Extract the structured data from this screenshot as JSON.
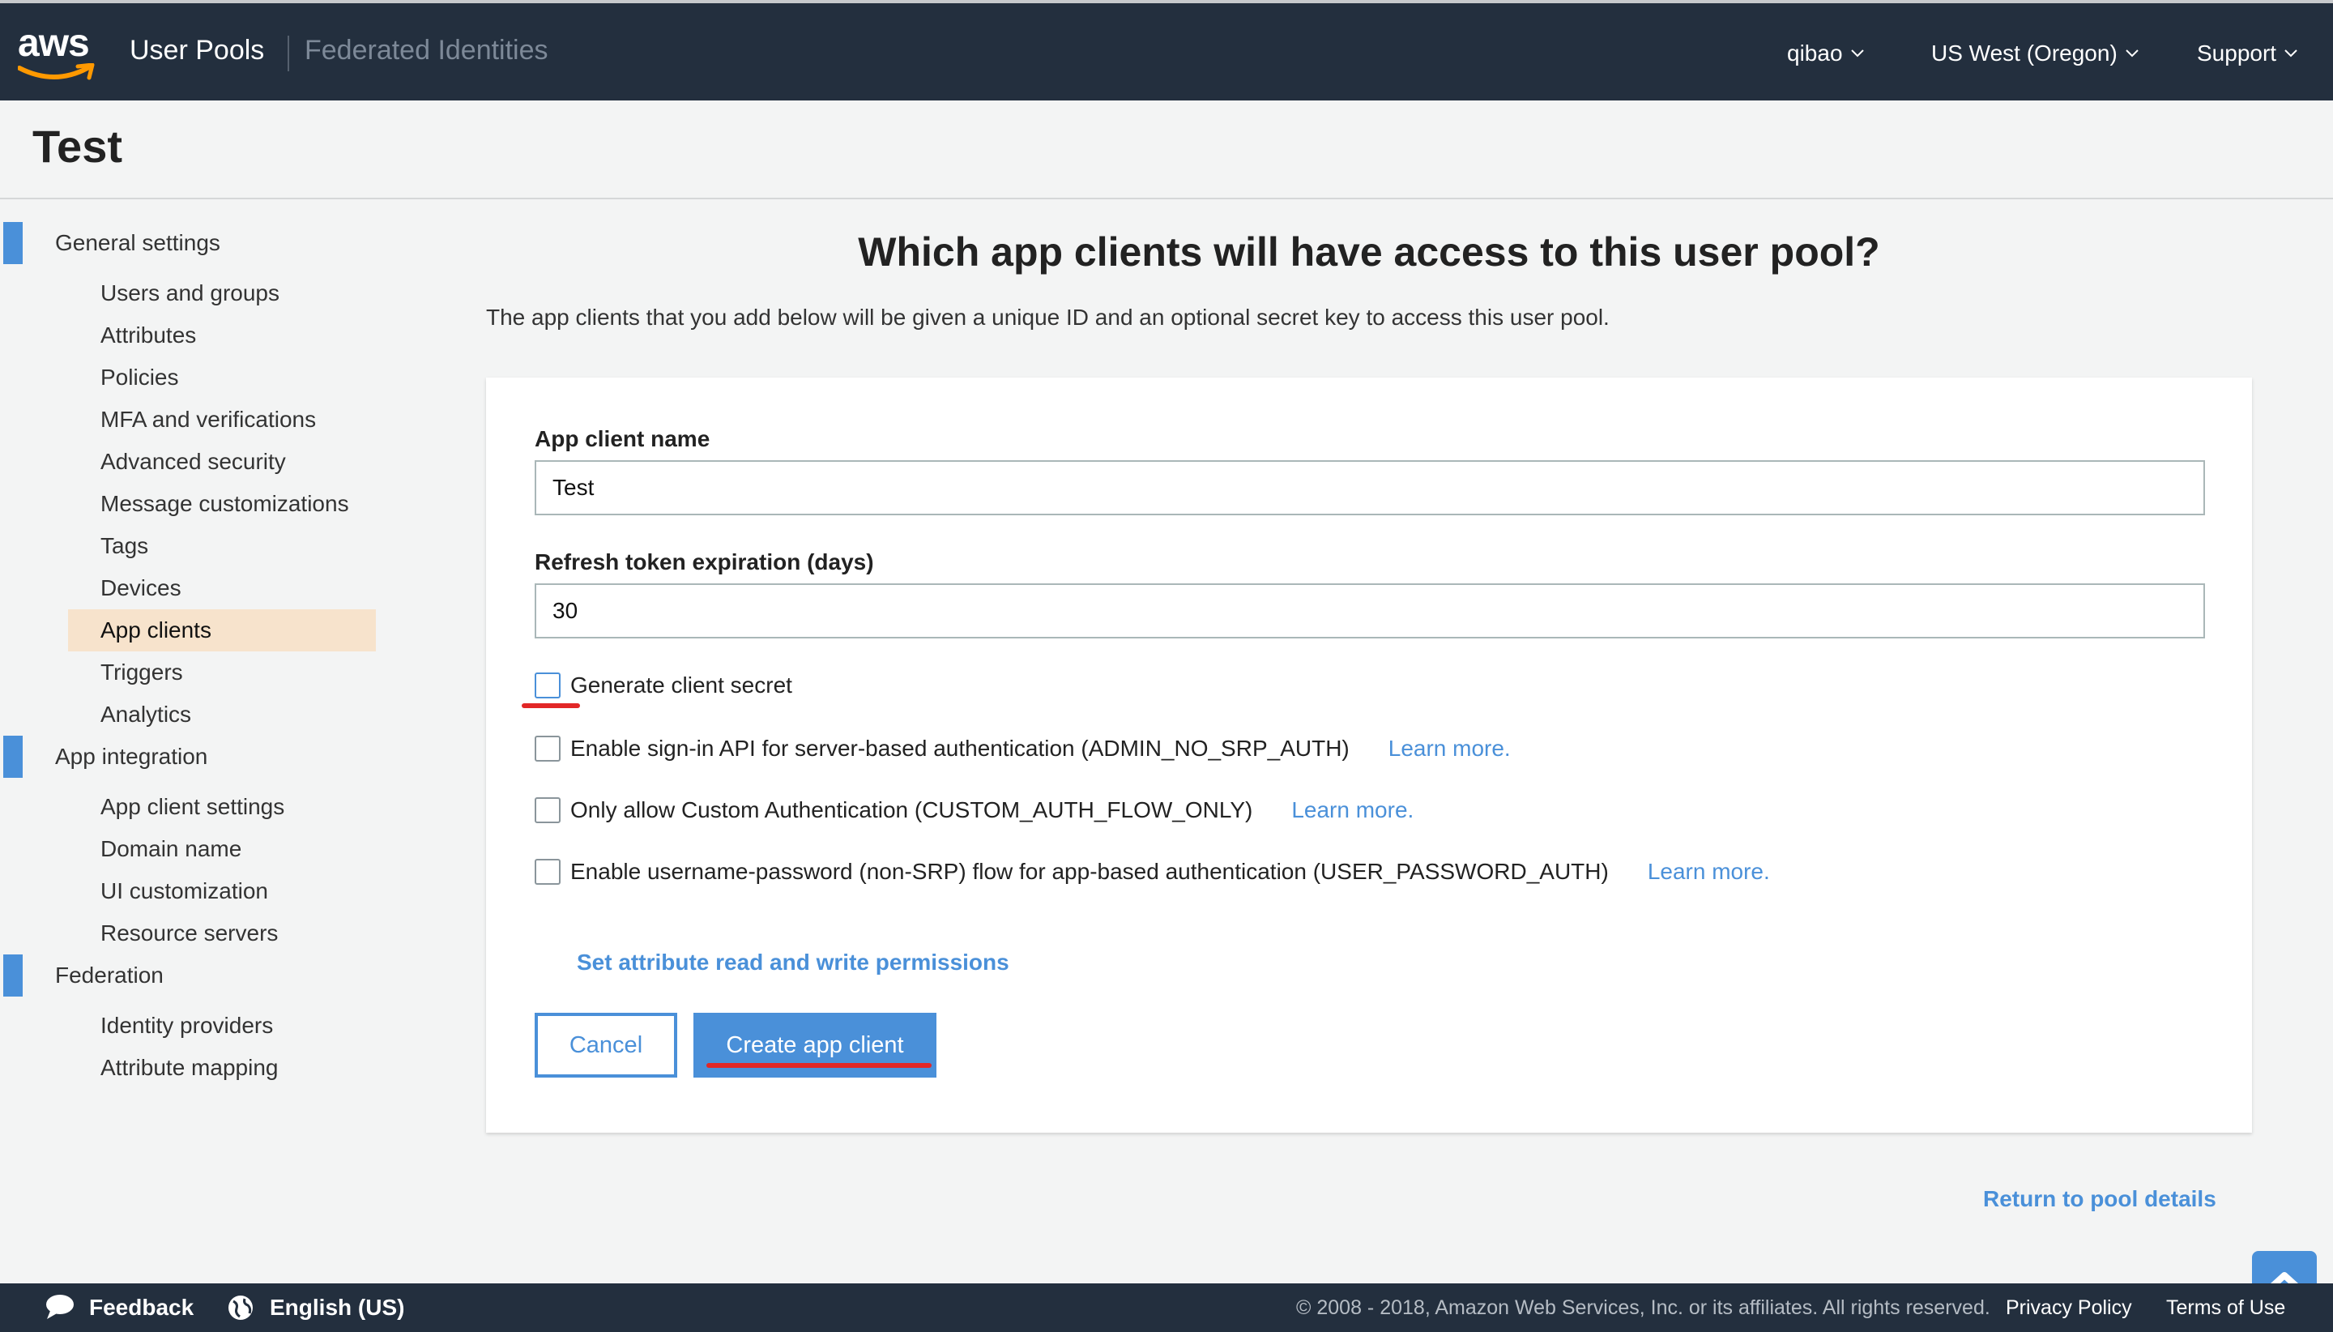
{
  "topnav": {
    "logo_text": "aws",
    "user_pools": "User Pools",
    "federated_identities": "Federated Identities",
    "account": "qibao",
    "region": "US West (Oregon)",
    "support": "Support"
  },
  "page": {
    "title": "Test"
  },
  "sidebar": {
    "sections": [
      {
        "label": "General settings",
        "items": [
          {
            "label": "Users and groups"
          },
          {
            "label": "Attributes"
          },
          {
            "label": "Policies"
          },
          {
            "label": "MFA and verifications"
          },
          {
            "label": "Advanced security"
          },
          {
            "label": "Message customizations"
          },
          {
            "label": "Tags"
          },
          {
            "label": "Devices"
          },
          {
            "label": "App clients",
            "active": true
          },
          {
            "label": "Triggers"
          },
          {
            "label": "Analytics"
          }
        ]
      },
      {
        "label": "App integration",
        "items": [
          {
            "label": "App client settings"
          },
          {
            "label": "Domain name"
          },
          {
            "label": "UI customization"
          },
          {
            "label": "Resource servers"
          }
        ]
      },
      {
        "label": "Federation",
        "items": [
          {
            "label": "Identity providers"
          },
          {
            "label": "Attribute mapping"
          }
        ]
      }
    ]
  },
  "main": {
    "heading": "Which app clients will have access to this user pool?",
    "description": "The app clients that you add below will be given a unique ID and an optional secret key to access this user pool.",
    "form": {
      "client_name_label": "App client name",
      "client_name_value": "Test",
      "refresh_label": "Refresh token expiration (days)",
      "refresh_value": "30",
      "options": [
        {
          "label": "Generate client secret",
          "checked": false,
          "learn_more": ""
        },
        {
          "label": "Enable sign-in API for server-based authentication (ADMIN_NO_SRP_AUTH)",
          "checked": false,
          "learn_more": "Learn more."
        },
        {
          "label": "Only allow Custom Authentication (CUSTOM_AUTH_FLOW_ONLY)",
          "checked": false,
          "learn_more": "Learn more."
        },
        {
          "label": "Enable username-password (non-SRP) flow for app-based authentication (USER_PASSWORD_AUTH)",
          "checked": false,
          "learn_more": "Learn more."
        }
      ],
      "permissions_link": "Set attribute read and write permissions",
      "cancel_label": "Cancel",
      "create_label": "Create app client"
    },
    "return_link": "Return to pool details"
  },
  "footer": {
    "feedback": "Feedback",
    "language": "English (US)",
    "copyright": "© 2008 - 2018, Amazon Web Services, Inc. or its affiliates. All rights reserved.",
    "privacy": "Privacy Policy",
    "terms": "Terms of Use"
  },
  "colors": {
    "nav_bg": "#232f3e",
    "accent": "#4a90d9",
    "active_item_bg": "#f7e3cc",
    "annotation_red": "#e22727"
  }
}
